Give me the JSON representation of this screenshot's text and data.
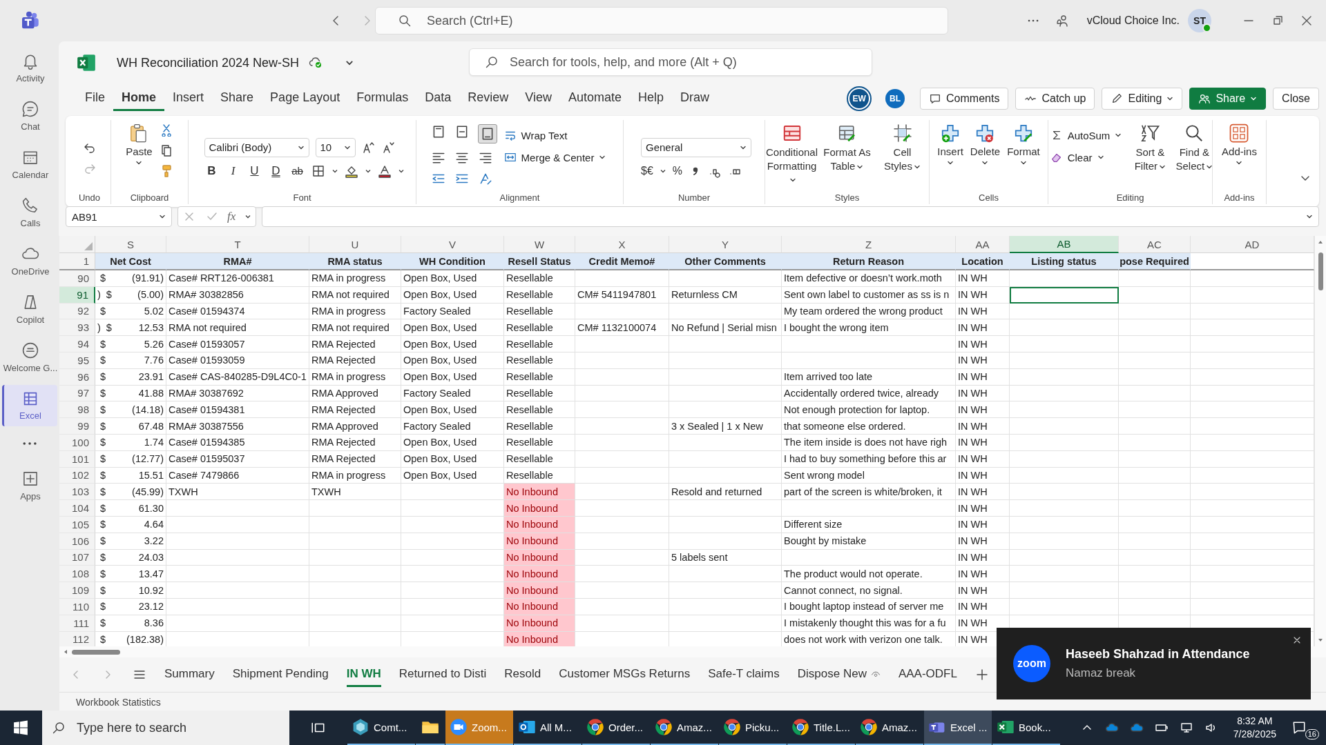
{
  "teams": {
    "search_placeholder": "Search (Ctrl+E)",
    "org": "vCloud Choice Inc.",
    "avatar": "ST",
    "rail": [
      {
        "label": "Activity",
        "selected": false
      },
      {
        "label": "Chat",
        "selected": false
      },
      {
        "label": "Calendar",
        "selected": false
      },
      {
        "label": "Calls",
        "selected": false
      },
      {
        "label": "OneDrive",
        "selected": false
      },
      {
        "label": "Copilot",
        "selected": false
      },
      {
        "label": "Welcome G...",
        "selected": false
      },
      {
        "label": "Excel",
        "selected": true
      }
    ],
    "apps_label": "Apps"
  },
  "excel": {
    "title": "WH Reconciliation 2024 New-SH",
    "search_placeholder": "Search for tools, help, and more (Alt + Q)",
    "menu": [
      {
        "label": "File",
        "selected": false
      },
      {
        "label": "Home",
        "selected": true
      },
      {
        "label": "Insert",
        "selected": false
      },
      {
        "label": "Share",
        "selected": false
      },
      {
        "label": "Page Layout",
        "selected": false
      },
      {
        "label": "Formulas",
        "selected": false
      },
      {
        "label": "Data",
        "selected": false
      },
      {
        "label": "Review",
        "selected": false
      },
      {
        "label": "View",
        "selected": false
      },
      {
        "label": "Automate",
        "selected": false
      },
      {
        "label": "Help",
        "selected": false
      },
      {
        "label": "Draw",
        "selected": false
      }
    ],
    "collaborators": [
      {
        "initials": "EW",
        "color": "#0f548c"
      },
      {
        "initials": "BL",
        "color": "#0f6cbd"
      }
    ],
    "buttons": {
      "comments": "Comments",
      "catch_up": "Catch up",
      "editing": "Editing",
      "share": "Share",
      "close": "Close"
    },
    "ribbon": {
      "undo_label": "Undo",
      "paste": "Paste",
      "clipboard_label": "Clipboard",
      "font": "Calibri (Body)",
      "font_size": "10",
      "font_buttons": [
        "B",
        "I",
        "U",
        "D",
        "ab"
      ],
      "font_label": "Font",
      "wrap_text": "Wrap Text",
      "merge_center": "Merge & Center",
      "alignment_label": "Alignment",
      "number_format": "General",
      "number_buttons": [
        "$€",
        "%"
      ],
      "number_label": "Number",
      "styles": [
        "Conditional Formatting",
        "Format As Table",
        "Cell Styles"
      ],
      "styles_label": "Styles",
      "cells": [
        "Insert",
        "Delete",
        "Format"
      ],
      "cells_label": "Cells",
      "autosum": "AutoSum",
      "clear": "Clear",
      "sort_filter": "Sort & Filter",
      "find_select": "Find & Select",
      "editing_label": "Editing",
      "addins": "Add-ins",
      "addins_label": "Add-ins"
    },
    "formula_bar": {
      "name_box": "AB91",
      "fx": "fx"
    },
    "columns": [
      {
        "letter": "S",
        "selected": false
      },
      {
        "letter": "T",
        "selected": false
      },
      {
        "letter": "U",
        "selected": false
      },
      {
        "letter": "V",
        "selected": false
      },
      {
        "letter": "W",
        "selected": false
      },
      {
        "letter": "X",
        "selected": false
      },
      {
        "letter": "Y",
        "selected": false
      },
      {
        "letter": "Z",
        "selected": false
      },
      {
        "letter": "AA",
        "selected": false
      },
      {
        "letter": "AB",
        "selected": true
      },
      {
        "letter": "AC",
        "selected": false
      },
      {
        "letter": "AD",
        "selected": false
      }
    ],
    "header_row": {
      "n": "1",
      "labels": [
        "Net Cost",
        "RMA#",
        "RMA status",
        "WH Condition",
        "Resell Status",
        "Credit Memo#",
        "Other Comments",
        "Return Reason",
        "Location",
        "Listing status",
        "pose Required"
      ]
    },
    "rows": [
      {
        "n": "90",
        "selected": false,
        "currency": "$",
        "net": "(91.91)",
        "rma": "Case# RRT126-006381",
        "rma_status": "RMA in progress",
        "condition": "Open Box, Used",
        "resell": "Resellable",
        "flagged": false,
        "reason": "Item defective or doesn’t work.moth",
        "location": "IN WH"
      },
      {
        "n": "91",
        "selected": true,
        "fragment": ")",
        "currency": "$",
        "net": "(5.00)",
        "rma": "RMA# 30382856",
        "rma_status": "RMA not required",
        "condition": "Open Box, Used",
        "resell": "Resellable",
        "flagged": false,
        "credit_memo": "CM# 5411947801",
        "comments": "Returnless CM",
        "reason": "Sent own label to customer as ss is n",
        "location": "IN WH"
      },
      {
        "n": "92",
        "selected": false,
        "currency": "$",
        "net": "5.02",
        "rma": "Case# 01594374",
        "rma_status": "RMA in progress",
        "condition": "Factory Sealed",
        "resell": "Resellable",
        "flagged": false,
        "reason": "My team ordered the wrong product",
        "location": "IN WH"
      },
      {
        "n": "93",
        "selected": false,
        "fragment": ")",
        "currency": "$",
        "net": "12.53",
        "rma": "RMA not required",
        "rma_status": "RMA not required",
        "condition": "Open Box, Used",
        "resell": "Resellable",
        "flagged": false,
        "credit_memo": "CM# 1132100074",
        "comments": "No Refund | Serial misn",
        "reason": "I bought the wrong item",
        "location": "IN WH"
      },
      {
        "n": "94",
        "selected": false,
        "currency": "$",
        "net": "5.26",
        "rma": "Case# 01593057",
        "rma_status": "RMA Rejected",
        "condition": "Open Box, Used",
        "resell": "Resellable",
        "flagged": false,
        "location": "IN WH"
      },
      {
        "n": "95",
        "selected": false,
        "currency": "$",
        "net": "7.76",
        "rma": "Case# 01593059",
        "rma_status": "RMA Rejected",
        "condition": "Open Box, Used",
        "resell": "Resellable",
        "flagged": false,
        "location": "IN WH"
      },
      {
        "n": "96",
        "selected": false,
        "currency": "$",
        "net": "23.91",
        "rma": "Case# CAS-840285-D9L4C0-1",
        "rma_status": "RMA in progress",
        "condition": "Open Box, Used",
        "resell": "Resellable",
        "flagged": false,
        "reason": "Item arrived too late",
        "location": "IN WH"
      },
      {
        "n": "97",
        "selected": false,
        "currency": "$",
        "net": "41.88",
        "rma": "RMA# 30387692",
        "rma_status": "RMA Approved",
        "condition": "Factory Sealed",
        "resell": "Resellable",
        "flagged": false,
        "reason": "Accidentally ordered twice, already",
        "location": "IN WH"
      },
      {
        "n": "98",
        "selected": false,
        "currency": "$",
        "net": "(14.18)",
        "rma": "Case# 01594381",
        "rma_status": "RMA Rejected",
        "condition": "Open Box, Used",
        "resell": "Resellable",
        "flagged": false,
        "reason": "Not enough protection for laptop.",
        "location": "IN WH"
      },
      {
        "n": "99",
        "selected": false,
        "currency": "$",
        "net": "67.48",
        "rma": "RMA# 30387556",
        "rma_status": "RMA Approved",
        "condition": "Factory Sealed",
        "resell": "Resellable",
        "flagged": false,
        "comments": "3 x Sealed | 1 x New",
        "reason": "that someone else ordered.",
        "location": "IN WH"
      },
      {
        "n": "100",
        "selected": false,
        "currency": "$",
        "net": "1.74",
        "rma": "Case# 01594385",
        "rma_status": "RMA Rejected",
        "condition": "Open Box, Used",
        "resell": "Resellable",
        "flagged": false,
        "reason": "The item inside is does not have righ",
        "location": "IN WH"
      },
      {
        "n": "101",
        "selected": false,
        "currency": "$",
        "net": "(12.77)",
        "rma": "Case# 01595037",
        "rma_status": "RMA Rejected",
        "condition": "Open Box, Used",
        "resell": "Resellable",
        "flagged": false,
        "reason": "I had to buy something before this ar",
        "location": "IN WH"
      },
      {
        "n": "102",
        "selected": false,
        "currency": "$",
        "net": "15.51",
        "rma": "Case# 7479866",
        "rma_status": "RMA in progress",
        "condition": "Open Box, Used",
        "resell": "Resellable",
        "flagged": false,
        "reason": "Sent wrong model",
        "location": "IN WH"
      },
      {
        "n": "103",
        "selected": false,
        "currency": "$",
        "net": "(45.99)",
        "rma": "TXWH",
        "rma_status": "TXWH",
        "resell": "No Inbound",
        "flagged": true,
        "comments": "Resold and returned",
        "reason": "part of the screen is white/broken, it",
        "location": "IN WH"
      },
      {
        "n": "104",
        "selected": false,
        "currency": "$",
        "net": "61.30",
        "resell": "No Inbound",
        "flagged": true,
        "location": "IN WH"
      },
      {
        "n": "105",
        "selected": false,
        "currency": "$",
        "net": "4.64",
        "resell": "No Inbound",
        "flagged": true,
        "reason": "Different size",
        "location": "IN WH"
      },
      {
        "n": "106",
        "selected": false,
        "currency": "$",
        "net": "3.22",
        "resell": "No Inbound",
        "flagged": true,
        "reason": "Bought by mistake",
        "location": "IN WH"
      },
      {
        "n": "107",
        "selected": false,
        "currency": "$",
        "net": "24.03",
        "resell": "No Inbound",
        "flagged": true,
        "comments": "5 labels sent",
        "location": "IN WH"
      },
      {
        "n": "108",
        "selected": false,
        "currency": "$",
        "net": "13.47",
        "resell": "No Inbound",
        "flagged": true,
        "reason": "The product would not operate.",
        "location": "IN WH"
      },
      {
        "n": "109",
        "selected": false,
        "currency": "$",
        "net": "10.92",
        "resell": "No Inbound",
        "flagged": true,
        "reason": "Cannot connect, no signal.",
        "location": "IN WH"
      },
      {
        "n": "110",
        "selected": false,
        "currency": "$",
        "net": "23.12",
        "resell": "No Inbound",
        "flagged": true,
        "reason": "I bought laptop instead of server me",
        "location": "IN WH"
      },
      {
        "n": "111",
        "selected": false,
        "currency": "$",
        "net": "8.36",
        "resell": "No Inbound",
        "flagged": true,
        "reason": "I mistakenly thought this was for a fu",
        "location": "IN WH"
      },
      {
        "n": "112",
        "selected": false,
        "currency": "$",
        "net": "(182.38)",
        "resell": "No Inbound",
        "flagged": true,
        "reason": "does not work with verizon one talk.",
        "location": "IN WH"
      }
    ],
    "sheets": [
      {
        "label": "Summary",
        "selected": false
      },
      {
        "label": "Shipment Pending",
        "selected": false
      },
      {
        "label": "IN WH",
        "selected": true
      },
      {
        "label": "Returned to Disti",
        "selected": false
      },
      {
        "label": "Resold",
        "selected": false
      },
      {
        "label": "Customer MSGs Returns",
        "selected": false
      },
      {
        "label": "Safe-T claims",
        "selected": false
      },
      {
        "label": "Dispose New",
        "selected": false,
        "hidden_icon": true
      },
      {
        "label": "AAA-ODFL",
        "selected": false
      }
    ],
    "status": "Workbook Statistics"
  },
  "toast": {
    "app": "zoom",
    "title": "Haseeb Shahzad in Attendance",
    "message": "Namaz break"
  },
  "taskbar": {
    "search_placeholder": "Type here to search",
    "apps": [
      {
        "label": "Comt...",
        "kind": "app",
        "focused": false,
        "flashing": false
      },
      {
        "kind": "folder",
        "focused": false,
        "flashing": false
      },
      {
        "label": "Zoom...",
        "kind": "zoom",
        "focused": false,
        "flashing": true
      },
      {
        "label": "All M...",
        "kind": "outlook",
        "focused": false,
        "flashing": false
      },
      {
        "label": "Order...",
        "kind": "chrome",
        "focused": false,
        "flashing": false
      },
      {
        "label": "Amaz...",
        "kind": "chrome",
        "focused": false,
        "flashing": false
      },
      {
        "label": "Picku...",
        "kind": "chrome",
        "focused": false,
        "flashing": false
      },
      {
        "label": "Title.L...",
        "kind": "chrome",
        "focused": false,
        "flashing": false
      },
      {
        "label": "Amaz...",
        "kind": "chrome",
        "focused": false,
        "flashing": false
      },
      {
        "label": "Excel ...",
        "kind": "teams",
        "focused": true,
        "flashing": false
      },
      {
        "label": "Book...",
        "kind": "excel",
        "focused": false,
        "flashing": false
      }
    ],
    "time": "8:32 AM",
    "date": "7/28/2025",
    "notifications": "16"
  }
}
